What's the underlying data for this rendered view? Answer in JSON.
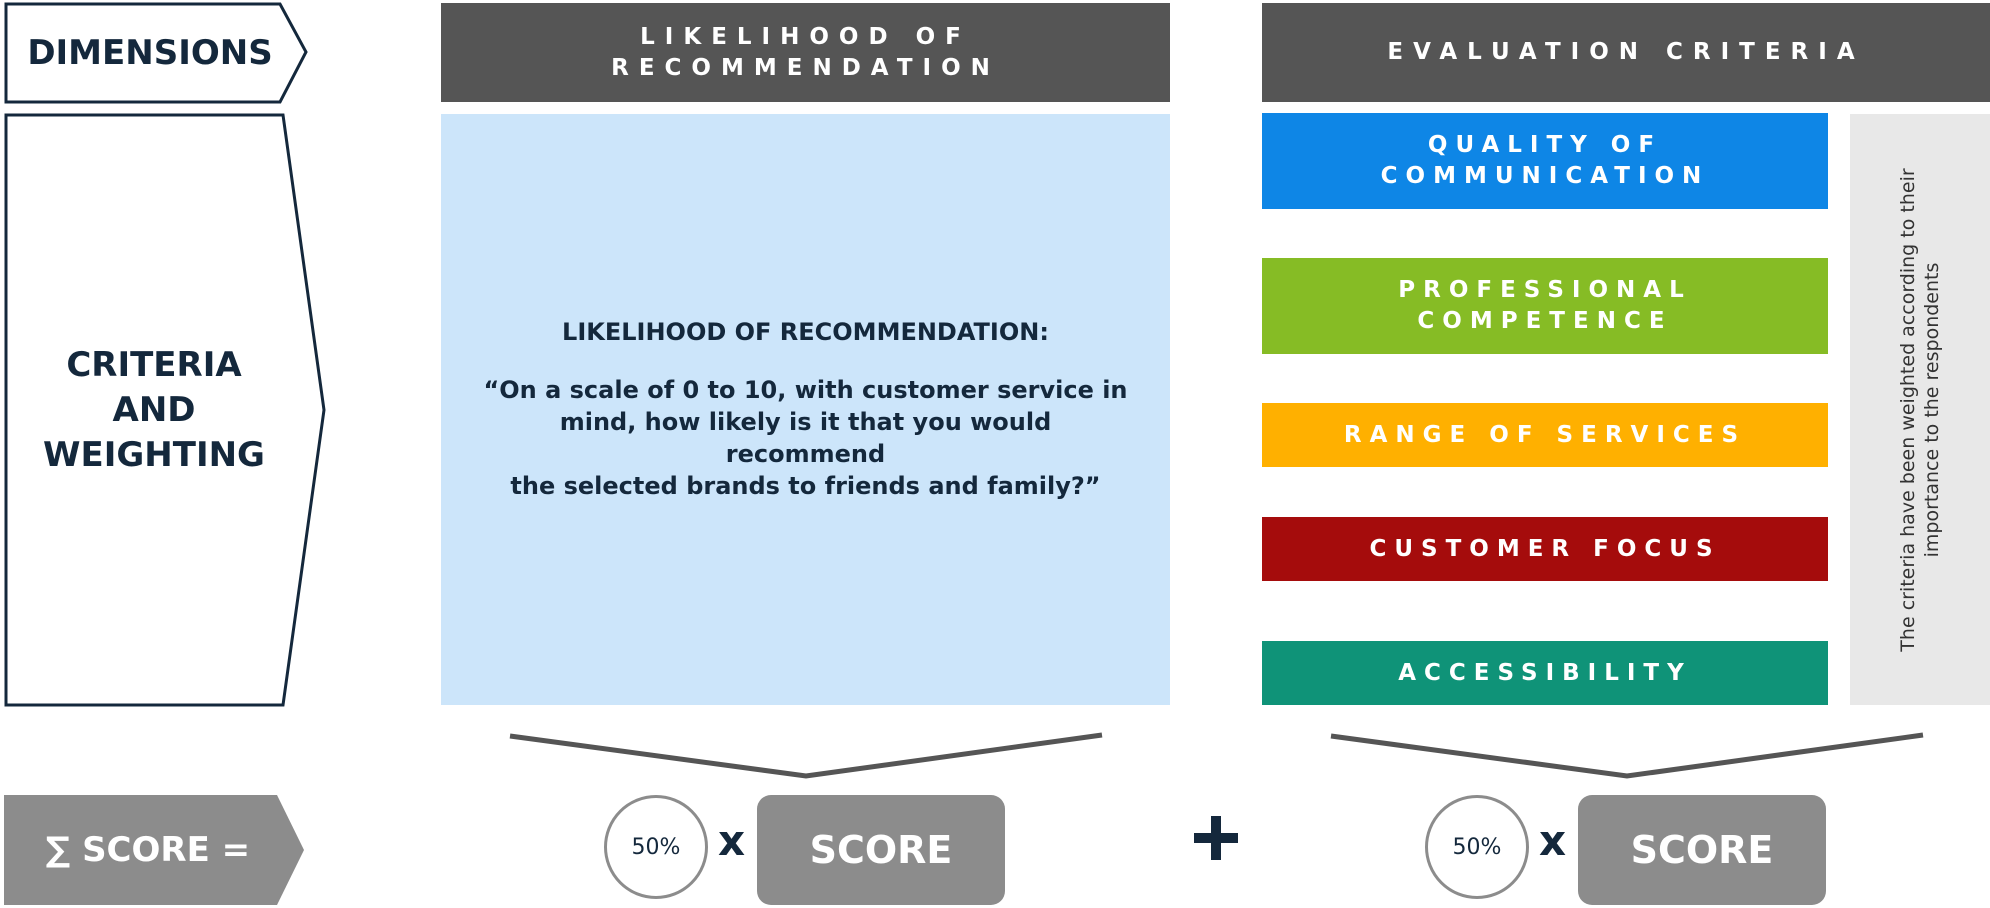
{
  "dimensions": {
    "label": "DIMENSIONS",
    "criteria_label_lines": [
      "CRITERIA",
      "AND",
      "WEIGHTING"
    ],
    "score_label": "∑ SCORE ="
  },
  "recommendation": {
    "header_lines": [
      "LIKELIHOOD OF",
      "RECOMMENDATION"
    ],
    "question_title": "LIKELIHOOD OF RECOMMENDATION:",
    "question_lines": [
      "“On a scale of 0 to 10, with customer service in",
      "mind, how likely is it that you would recommend",
      "the selected brands to friends and family?”"
    ]
  },
  "evaluation": {
    "header": "EVALUATION CRITERIA",
    "criteria": [
      {
        "lines": [
          "QUALITY OF",
          "COMMUNICATION"
        ],
        "color": "#0e86e6"
      },
      {
        "lines": [
          "PROFESSIONAL",
          "COMPETENCE"
        ],
        "color": "#86bc25"
      },
      {
        "lines": [
          "RANGE OF SERVICES"
        ],
        "color": "#ffb000"
      },
      {
        "lines": [
          "CUSTOMER FOCUS"
        ],
        "color": "#a50c0c"
      },
      {
        "lines": [
          "ACCESSIBILITY"
        ],
        "color": "#0f9378"
      }
    ],
    "note_lines": [
      "The criteria have been weighted according to their",
      "importance to the respondents"
    ]
  },
  "formula": {
    "left_weight": "50%",
    "right_weight": "50%",
    "times_symbol": "x",
    "score_label": "SCORE"
  },
  "colors": {
    "navy": "#14283c",
    "header_gray": "#555555",
    "score_gray": "#8c8c8c",
    "question_bg": "#cce5fa",
    "note_bg": "#e8e8e8"
  }
}
